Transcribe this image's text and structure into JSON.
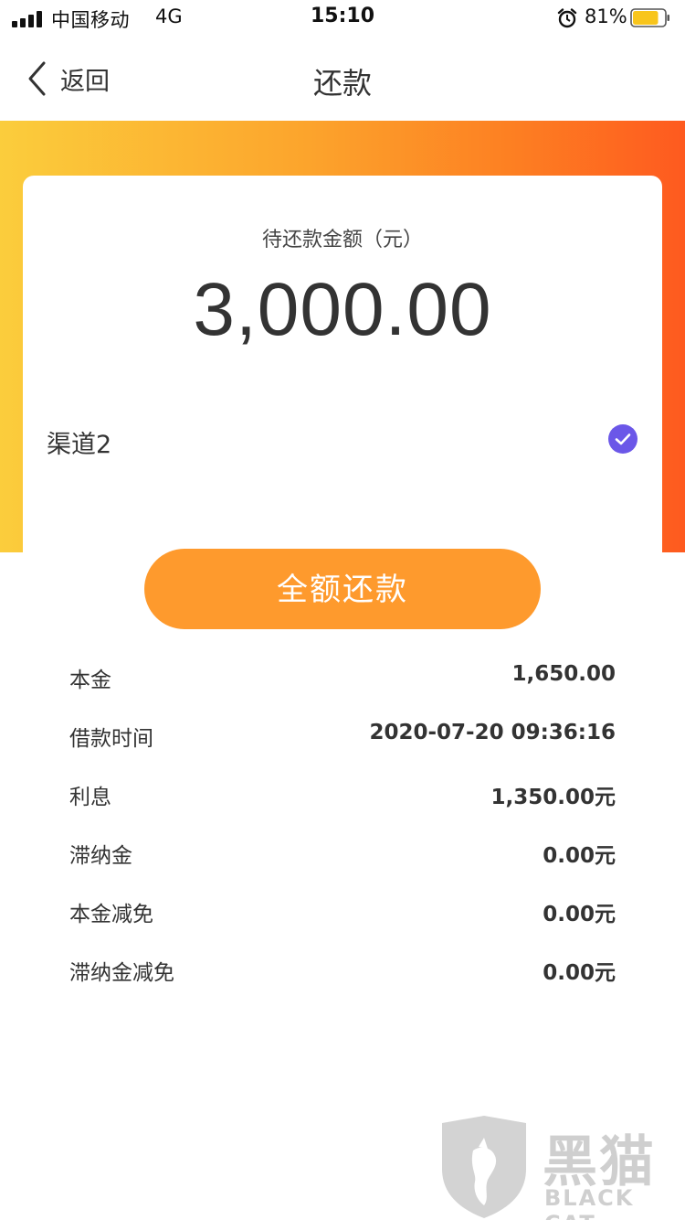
{
  "status_bar": {
    "carrier": "中国移动",
    "network": "4G",
    "time": "15:10",
    "battery_percent": "81%",
    "battery_level": 0.81,
    "battery_color": "#f8c51c"
  },
  "nav": {
    "back_label": "返回",
    "title": "还款"
  },
  "card": {
    "amount_label": "待还款金额（元）",
    "amount": "3,000.00",
    "channel": "渠道2",
    "channel_selected": true,
    "check_color": "#6b57e8"
  },
  "pay_button": {
    "label": "全额还款",
    "color": "#fe9a2d"
  },
  "details": [
    {
      "key": "本金",
      "value": "1,650.00"
    },
    {
      "key": "借款时间",
      "value": "2020-07-20 09:36:16"
    },
    {
      "key": "利息",
      "value": "1,350.00元"
    },
    {
      "key": "滞纳金",
      "value": "0.00元"
    },
    {
      "key": "本金减免",
      "value": "0.00元"
    },
    {
      "key": "滞纳金减免",
      "value": "0.00元"
    }
  ],
  "watermark": {
    "text_cn": "黑猫",
    "text_en": "BLACK CAT"
  },
  "colors": {
    "gradient_start": "#fbcd3c",
    "gradient_end": "#fe5a1f",
    "text_primary": "#333333"
  }
}
